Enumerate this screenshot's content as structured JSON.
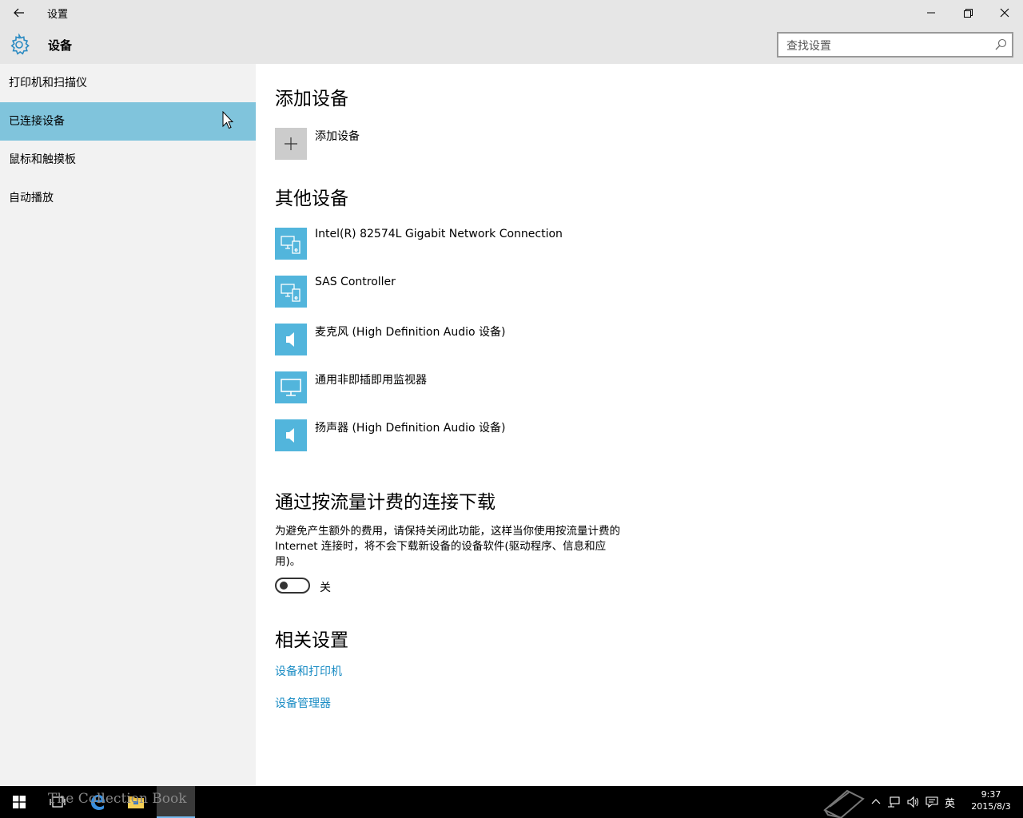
{
  "window": {
    "title": "设置",
    "buttons": {
      "minimize": "minimize",
      "restore": "restore",
      "close": "close"
    }
  },
  "header": {
    "title": "设备",
    "search_placeholder": "查找设置"
  },
  "sidebar": {
    "items": [
      {
        "label": "打印机和扫描仪",
        "active": false
      },
      {
        "label": "已连接设备",
        "active": true
      },
      {
        "label": "鼠标和触摸板",
        "active": false
      },
      {
        "label": "自动播放",
        "active": false
      }
    ]
  },
  "main": {
    "add_section": {
      "heading": "添加设备",
      "add_label": "添加设备"
    },
    "other_section": {
      "heading": "其他设备",
      "devices": [
        {
          "name": "Intel(R) 82574L Gigabit Network Connection",
          "icon": "devices-icon"
        },
        {
          "name": "SAS Controller",
          "icon": "devices-icon"
        },
        {
          "name": "麦克风 (High Definition Audio 设备)",
          "icon": "speaker-icon"
        },
        {
          "name": "通用非即插即用监视器",
          "icon": "monitor-icon"
        },
        {
          "name": "扬声器 (High Definition Audio 设备)",
          "icon": "speaker-icon"
        }
      ]
    },
    "metered_section": {
      "heading": "通过按流量计费的连接下载",
      "description": "为避免产生额外的费用，请保持关闭此功能，这样当你使用按流量计费的 Internet 连接时，将不会下载新设备的设备软件(驱动程序、信息和应用)。",
      "toggle_label": "关",
      "toggle_on": false
    },
    "related_section": {
      "heading": "相关设置",
      "links": [
        "设备和打印机",
        "设备管理器"
      ]
    }
  },
  "taskbar": {
    "clock_time": "9:37",
    "clock_date": "2015/8/3",
    "ime": "英",
    "watermark": "The Collection Book"
  },
  "colors": {
    "accent": "#80c4dc",
    "tile": "#52b5dc",
    "link": "#1a8cc4"
  }
}
